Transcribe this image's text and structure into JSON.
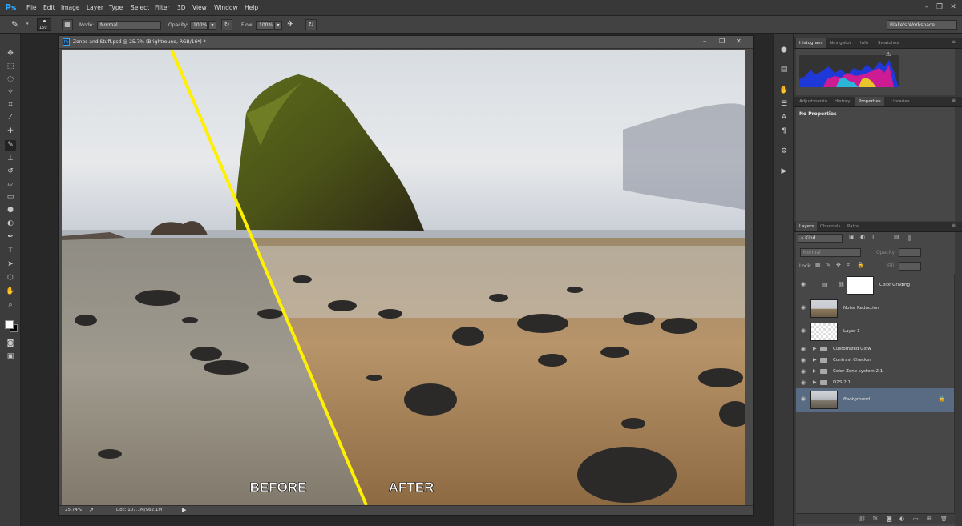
{
  "app": {
    "logo": "Ps",
    "brand_color": "#31a8ff"
  },
  "menu": [
    "File",
    "Edit",
    "Image",
    "Layer",
    "Type",
    "Select",
    "Filter",
    "3D",
    "View",
    "Window",
    "Help"
  ],
  "window_controls": {
    "minimize": "–",
    "restore": "❐",
    "close": "✕"
  },
  "options_bar": {
    "brush_size": "150",
    "mode_label": "Mode:",
    "mode_value": "Normal",
    "opacity_label": "Opacity:",
    "opacity_value": "100%",
    "flow_label": "Flow:",
    "flow_value": "100%",
    "workspace": "Blake's Workspace"
  },
  "document": {
    "tab_title": "Zones and Stuff.psd @ 25.7% (Brightround, RGB/16*) *",
    "zoom": "25.74%",
    "doc_size": "Doc: 107.1M/962.1M",
    "before_label": "BEFORE",
    "after_label": "AFTER",
    "divider_color": "#ffef00"
  },
  "panels": {
    "top_tabs": [
      "Histogram",
      "Navigator",
      "Info",
      "Swatches"
    ],
    "mid_tabs": [
      "Adjustments",
      "History",
      "Properties",
      "Libraries"
    ],
    "properties_text": "No Properties",
    "layers_tabs": [
      "Layers",
      "Channels",
      "Paths"
    ],
    "filter_kind": "Kind",
    "blend_mode": "Normal",
    "opacity_label": "Opacity:",
    "fill_label": "Fill:",
    "lock_label": "Lock:",
    "layers": [
      {
        "name": "Color Grading"
      },
      {
        "name": "Noise Reduction"
      },
      {
        "name": "Layer 1"
      },
      {
        "name": "Customized Glow"
      },
      {
        "name": "Contrast Checker"
      },
      {
        "name": "Color Zone system 2.1"
      },
      {
        "name": "DZS 2.1"
      },
      {
        "name": "Background"
      }
    ]
  },
  "icons": [
    "move-icon",
    "marquee-icon",
    "lasso-icon",
    "quick-select-icon",
    "crop-icon",
    "eyedropper-icon",
    "healing-icon",
    "brush-icon",
    "stamp-icon",
    "history-brush-icon",
    "eraser-icon",
    "gradient-icon",
    "blur-icon",
    "dodge-icon",
    "pen-icon",
    "type-icon",
    "path-select-icon",
    "shape-icon",
    "hand-icon",
    "zoom-icon",
    "eye-icon",
    "folder-icon",
    "lock-icon",
    "link-icon",
    "trash-icon"
  ]
}
